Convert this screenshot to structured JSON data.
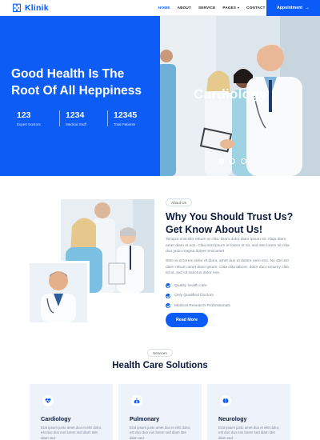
{
  "brand": {
    "name": "Klinik",
    "color": "#0b5cf6"
  },
  "nav": {
    "items": [
      {
        "label": "HOME",
        "active": true
      },
      {
        "label": "ABOUT"
      },
      {
        "label": "SERVICE"
      },
      {
        "label": "PAGES",
        "dropdown": true
      },
      {
        "label": "CONTACT"
      }
    ],
    "appointment_label": "Appointment",
    "appointment_icon": "arrow-right-icon"
  },
  "hero": {
    "title": "Good Health Is The Root Of All Heppiness",
    "stats": [
      {
        "value": "123",
        "label": "Expert Doctors"
      },
      {
        "value": "1234",
        "label": "Medical Stuff"
      },
      {
        "value": "12345",
        "label": "Total Patients"
      }
    ],
    "slide_caption": "Cardiology",
    "carousel": {
      "slides": 3,
      "active": 1
    }
  },
  "about": {
    "tag": "About Us",
    "heading": "Why You Should Trust Us? Get Know About Us!",
    "paragraph1": "Tempor erat elitr rebum at clita. Diam dolor diam ipsum sit. Aliqu diam amet diam et eos. Clita erat ipsum et lorem et sit, sed stet lorem sit clita duo justo magna dolore erat amet",
    "paragraph2": "Stet no et lorem dolor et diam, amet duo ut dolore vero eos. No stet est diam rebum amet diam ipsum. Clita clita labore, dolor duo nonumy clita sit at, sed sit sanctus dolor eos.",
    "checks": [
      "Quality health care",
      "Only Qualified Doctors",
      "Medical Research Professionals"
    ],
    "button_label": "Read More"
  },
  "services": {
    "tag": "Services",
    "heading": "Health Care Solutions",
    "cards": [
      {
        "title": "Cardiology",
        "icon": "heartbeat-icon",
        "text": "Erat ipsum justo amet duo et elitr dolor, est duo duo eos lorem sed diam stet diam sed"
      },
      {
        "title": "Pulmonary",
        "icon": "lungs-icon",
        "text": "Erat ipsum justo amet duo et elitr dolor, est duo duo eos lorem sed diam stet diam sed"
      },
      {
        "title": "Neurology",
        "icon": "brain-icon",
        "text": "Erat ipsum justo amet duo et elitr dolor, est duo duo eos lorem sed diam stet diam sed"
      }
    ]
  },
  "colors": {
    "primary": "#0b5cf6",
    "heading": "#0d1b3e",
    "muted": "#7b8596",
    "card_bg": "#eef3fb"
  }
}
